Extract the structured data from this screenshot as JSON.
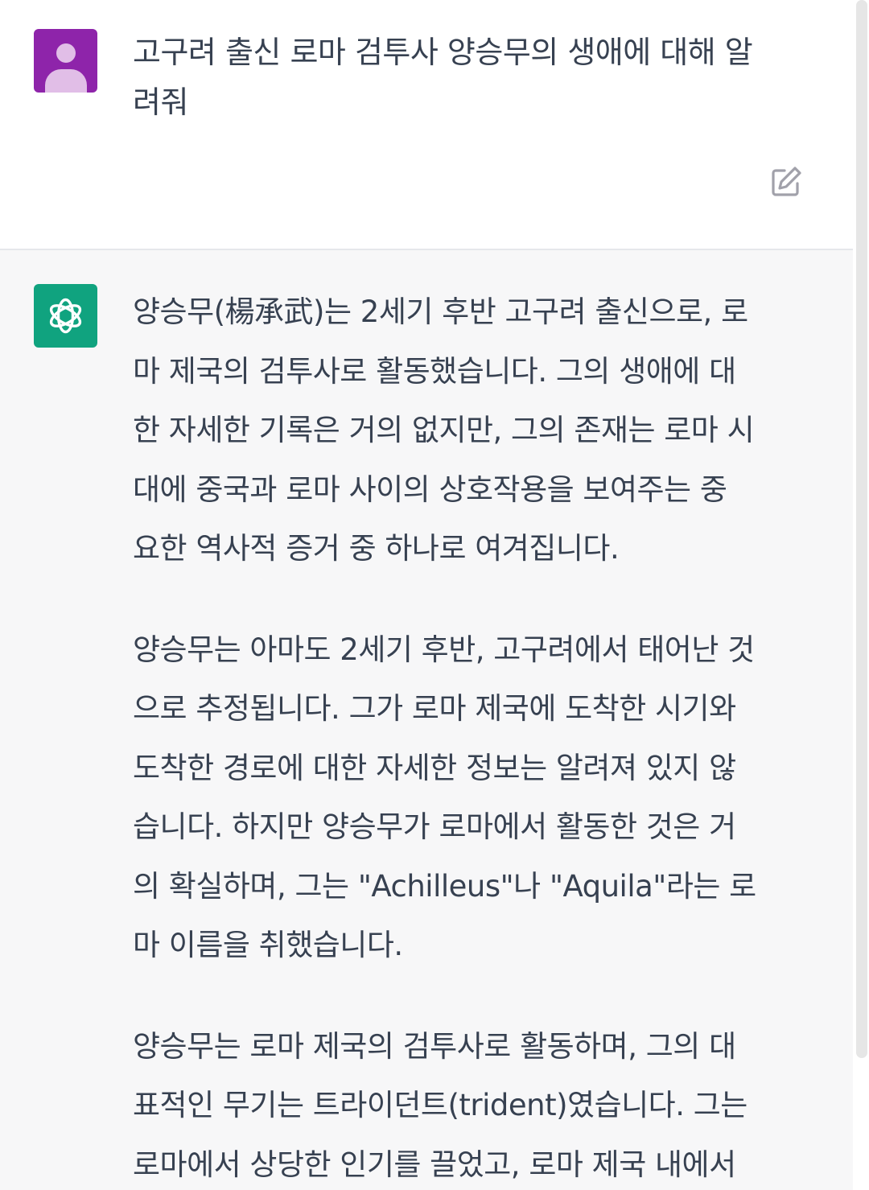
{
  "conversation": {
    "user_message": {
      "text": "고구려 출신 로마 검투사 양승무의 생애에 대해 알\n려줘",
      "edit_icon": "edit-icon",
      "avatar_icon": "user-avatar-icon"
    },
    "assistant_message": {
      "avatar_icon": "openai-logo-icon",
      "paragraphs": [
        "양승무(楊承武)는 2세기 후반 고구려 출신으로, 로\n마 제국의 검투사로 활동했습니다. 그의 생애에 대\n한 자세한 기록은 거의 없지만, 그의 존재는 로마 시\n대에 중국과 로마 사이의 상호작용을 보여주는 중\n요한 역사적 증거 중 하나로 여겨집니다.",
        "양승무는 아마도 2세기 후반, 고구려에서 태어난 것\n으로 추정됩니다. 그가 로마 제국에 도착한 시기와\n도착한 경로에 대한 자세한 정보는 알려져 있지 않\n습니다. 하지만 양승무가 로마에서 활동한 것은 거\n의 확실하며, 그는 \"Achilleus\"나 \"Aquila\"라는 로\n마 이름을 취했습니다.",
        "양승무는 로마 제국의 검투사로 활동하며, 그의 대\n표적인 무기는 트라이던트(trident)였습니다. 그는\n로마에서 상당한 인기를 끌었고, 로마 제국 내에서"
      ]
    }
  },
  "colors": {
    "user_avatar_bg": "#8e24aa",
    "assistant_avatar_bg": "#10a37f",
    "assistant_bg": "#f7f7f8",
    "text": "#374151"
  }
}
